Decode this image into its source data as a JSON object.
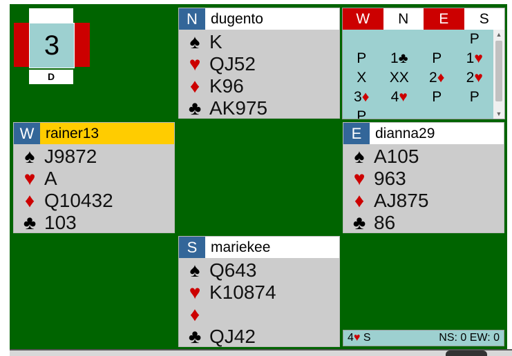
{
  "board": {
    "number": "3",
    "dealer": "D",
    "vul_color": "#cc0000"
  },
  "north": {
    "seat": "N",
    "name": "dugento",
    "spades": "K",
    "hearts": "QJ52",
    "diamonds": "K96",
    "clubs": "AK975"
  },
  "west": {
    "seat": "W",
    "name": "rainer13",
    "spades": "J9872",
    "hearts": "A",
    "diamonds": "Q10432",
    "clubs": "103"
  },
  "east": {
    "seat": "E",
    "name": "dianna29",
    "spades": "A105",
    "hearts": "963",
    "diamonds": "AJ875",
    "clubs": "86"
  },
  "south": {
    "seat": "S",
    "name": "mariekee",
    "spades": "Q643",
    "hearts": "K10874",
    "diamonds": "",
    "clubs": "QJ42"
  },
  "icons": {
    "spade": "♠",
    "heart": "♥",
    "diamond": "♦",
    "club": "♣"
  },
  "bidding": {
    "headers": [
      "W",
      "N",
      "E",
      "S"
    ],
    "rows": [
      [
        {
          "t": ""
        },
        {
          "t": ""
        },
        {
          "t": ""
        },
        {
          "t": "P"
        }
      ],
      [
        {
          "t": "P"
        },
        {
          "t": "1",
          "s": "♣",
          "c": "b"
        },
        {
          "t": "P"
        },
        {
          "t": "1",
          "s": "♥",
          "c": "r"
        }
      ],
      [
        {
          "t": "X"
        },
        {
          "t": "XX"
        },
        {
          "t": "2",
          "s": "♦",
          "c": "r"
        },
        {
          "t": "2",
          "s": "♥",
          "c": "r"
        }
      ],
      [
        {
          "t": "3",
          "s": "♦",
          "c": "r"
        },
        {
          "t": "4",
          "s": "♥",
          "c": "r"
        },
        {
          "t": "P"
        },
        {
          "t": "P"
        }
      ],
      [
        {
          "t": "P"
        },
        {
          "t": ""
        },
        {
          "t": ""
        },
        {
          "t": ""
        }
      ]
    ]
  },
  "status": {
    "contract_level": "4",
    "contract_suit": "♥",
    "contract_declarer": "S",
    "score": "NS: 0 EW: 0"
  },
  "colors": {
    "table": "#006400",
    "seat_badge": "#336699",
    "active_name": "#ffcc00",
    "panel": "#9dd0d0",
    "red": "#cc0000"
  }
}
